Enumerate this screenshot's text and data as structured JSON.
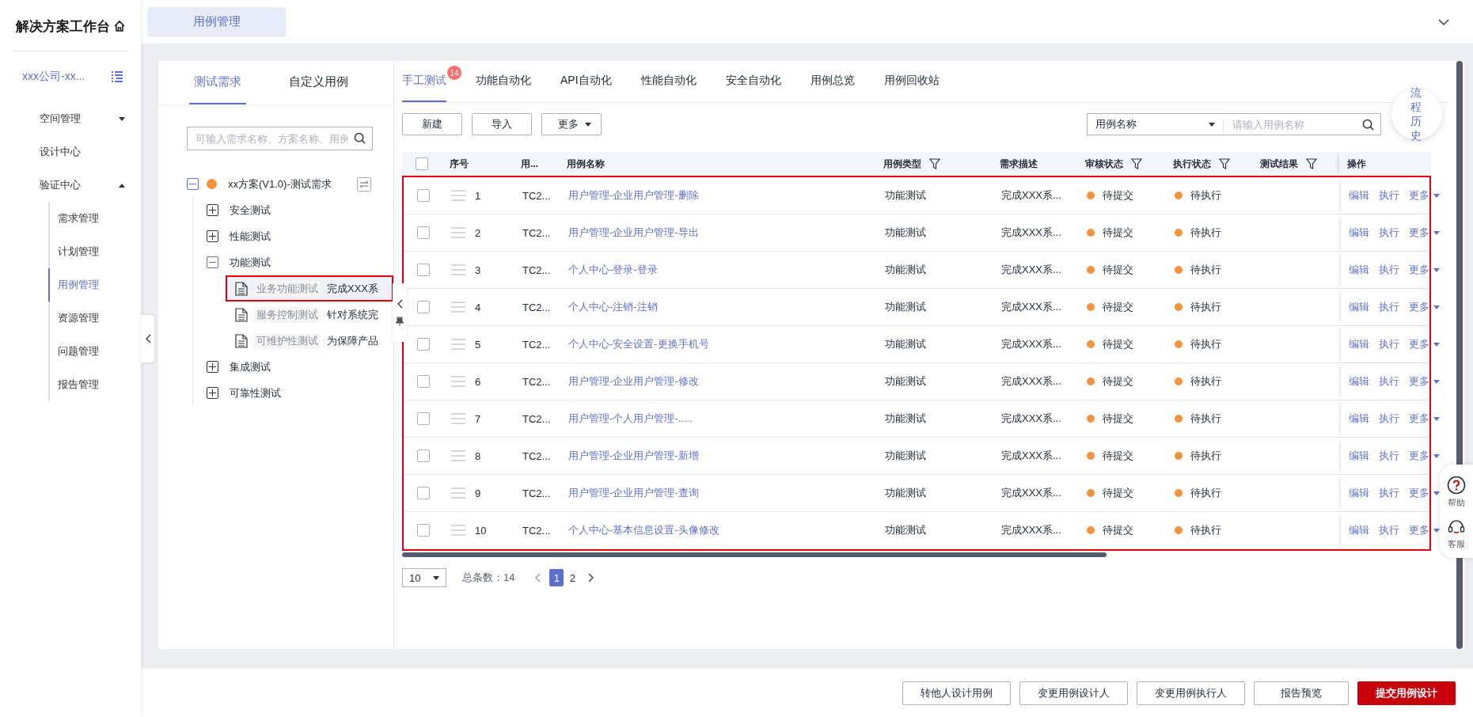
{
  "sidebar": {
    "title": "解决方案工作台",
    "org": "xxx公司-xx...",
    "items": [
      {
        "label": "空间管理",
        "expanded": false
      },
      {
        "label": "设计中心"
      },
      {
        "label": "验证中心",
        "expanded": true,
        "children": [
          {
            "label": "需求管理",
            "selected": false
          },
          {
            "label": "计划管理",
            "selected": false
          },
          {
            "label": "用例管理",
            "selected": true
          },
          {
            "label": "资源管理",
            "selected": false
          },
          {
            "label": "问题管理",
            "selected": false
          },
          {
            "label": "报告管理",
            "selected": false
          }
        ]
      }
    ]
  },
  "page_tab": "用例管理",
  "left_panel": {
    "tabs": [
      {
        "label": "测试需求",
        "selected": true
      },
      {
        "label": "自定义用例",
        "selected": false
      }
    ],
    "search": {
      "placeholder": "可输入需求名称、方案名称、用例"
    },
    "tree": {
      "label": "xx方案(V1.0)-测试需求",
      "color": "#f5923e",
      "expanded": true,
      "children": [
        {
          "kind": "group",
          "label": "安全测试",
          "expanded": false
        },
        {
          "kind": "group",
          "label": "性能测试",
          "expanded": false
        },
        {
          "kind": "group",
          "label": "功能测试",
          "expanded": true,
          "children": [
            {
              "kind": "doc",
              "label": "业务功能测试",
              "desc": "完成XXX系",
              "selected": true,
              "highlighted": true
            },
            {
              "kind": "doc",
              "label": "服务控制测试",
              "desc": "针对系统完",
              "selected": false,
              "highlighted": false
            },
            {
              "kind": "doc",
              "label": "可维护性测试",
              "desc": "为保障产品",
              "selected": false,
              "highlighted": false
            }
          ]
        },
        {
          "kind": "group",
          "label": "集成测试",
          "expanded": false
        },
        {
          "kind": "group",
          "label": "可靠性测试",
          "expanded": false
        }
      ]
    }
  },
  "tabs": [
    {
      "label": "手工测试",
      "selected": true,
      "badge": "14"
    },
    {
      "label": "功能自动化",
      "selected": false
    },
    {
      "label": "API自动化",
      "selected": false
    },
    {
      "label": "性能自动化",
      "selected": false
    },
    {
      "label": "安全自动化",
      "selected": false
    },
    {
      "label": "用例总览",
      "selected": false
    },
    {
      "label": "用例回收站",
      "selected": false
    }
  ],
  "toolbar": {
    "buttons": [
      {
        "label": "新建",
        "caret": false
      },
      {
        "label": "导入",
        "caret": false
      },
      {
        "label": "更多",
        "caret": true
      }
    ],
    "search_field": "用例名称",
    "search": {
      "placeholder": "请输入用例名称"
    }
  },
  "float_button": "流程历史",
  "table": {
    "highlighted": true,
    "all_checked": false,
    "columns": [
      {
        "label": "序号",
        "filter": false
      },
      {
        "label": "用...",
        "filter": false
      },
      {
        "label": "用例名称",
        "filter": false
      },
      {
        "label": "用例类型",
        "filter": true
      },
      {
        "label": "需求描述",
        "filter": false
      },
      {
        "label": "审核状态",
        "filter": true
      },
      {
        "label": "执行状态",
        "filter": true
      },
      {
        "label": "测试结果",
        "filter": true
      },
      {
        "label": "操作",
        "filter": false
      }
    ],
    "rows": [
      {
        "checked": false,
        "seq": "1",
        "id": "TC2...",
        "name": "用户管理-企业用户管理-删除",
        "type": "功能测试",
        "desc": "完成XXX系...",
        "audit": {
          "text": "待提交",
          "color": "#f5923e"
        },
        "exec": {
          "text": "待执行",
          "color": "#f5923e"
        },
        "actions": [
          "编辑",
          "执行",
          "更多"
        ]
      },
      {
        "checked": false,
        "seq": "2",
        "id": "TC2...",
        "name": "用户管理-企业用户管理-导出",
        "type": "功能测试",
        "desc": "完成XXX系...",
        "audit": {
          "text": "待提交",
          "color": "#f5923e"
        },
        "exec": {
          "text": "待执行",
          "color": "#f5923e"
        },
        "actions": [
          "编辑",
          "执行",
          "更多"
        ]
      },
      {
        "checked": false,
        "seq": "3",
        "id": "TC2...",
        "name": "个人中心-登录-登录",
        "type": "功能测试",
        "desc": "完成XXX系...",
        "audit": {
          "text": "待提交",
          "color": "#f5923e"
        },
        "exec": {
          "text": "待执行",
          "color": "#f5923e"
        },
        "actions": [
          "编辑",
          "执行",
          "更多"
        ]
      },
      {
        "checked": false,
        "seq": "4",
        "id": "TC2...",
        "name": "个人中心-注销-注销",
        "type": "功能测试",
        "desc": "完成XXX系...",
        "audit": {
          "text": "待提交",
          "color": "#f5923e"
        },
        "exec": {
          "text": "待执行",
          "color": "#f5923e"
        },
        "actions": [
          "编辑",
          "执行",
          "更多"
        ]
      },
      {
        "checked": false,
        "seq": "5",
        "id": "TC2...",
        "name": "个人中心-安全设置-更换手机号",
        "type": "功能测试",
        "desc": "完成XXX系...",
        "audit": {
          "text": "待提交",
          "color": "#f5923e"
        },
        "exec": {
          "text": "待执行",
          "color": "#f5923e"
        },
        "actions": [
          "编辑",
          "执行",
          "更多"
        ]
      },
      {
        "checked": false,
        "seq": "6",
        "id": "TC2...",
        "name": "用户管理-企业用户管理-修改",
        "type": "功能测试",
        "desc": "完成XXX系...",
        "audit": {
          "text": "待提交",
          "color": "#f5923e"
        },
        "exec": {
          "text": "待执行",
          "color": "#f5923e"
        },
        "actions": [
          "编辑",
          "执行",
          "更多"
        ]
      },
      {
        "checked": false,
        "seq": "7",
        "id": "TC2...",
        "name": "用户管理-个人用户管理-.....",
        "type": "功能测试",
        "desc": "完成XXX系...",
        "audit": {
          "text": "待提交",
          "color": "#f5923e"
        },
        "exec": {
          "text": "待执行",
          "color": "#f5923e"
        },
        "actions": [
          "编辑",
          "执行",
          "更多"
        ]
      },
      {
        "checked": false,
        "seq": "8",
        "id": "TC2...",
        "name": "用户管理-企业用户管理-新增",
        "type": "功能测试",
        "desc": "完成XXX系...",
        "audit": {
          "text": "待提交",
          "color": "#f5923e"
        },
        "exec": {
          "text": "待执行",
          "color": "#f5923e"
        },
        "actions": [
          "编辑",
          "执行",
          "更多"
        ]
      },
      {
        "checked": false,
        "seq": "9",
        "id": "TC2...",
        "name": "用户管理-企业用户管理-查询",
        "type": "功能测试",
        "desc": "完成XXX系...",
        "audit": {
          "text": "待提交",
          "color": "#f5923e"
        },
        "exec": {
          "text": "待执行",
          "color": "#f5923e"
        },
        "actions": [
          "编辑",
          "执行",
          "更多"
        ]
      },
      {
        "checked": false,
        "seq": "10",
        "id": "TC2...",
        "name": "个人中心-基本信息设置-头像修改",
        "type": "功能测试",
        "desc": "完成XXX系...",
        "audit": {
          "text": "待提交",
          "color": "#f5923e"
        },
        "exec": {
          "text": "待执行",
          "color": "#f5923e"
        },
        "actions": [
          "编辑",
          "执行",
          "更多"
        ]
      }
    ]
  },
  "pagination": {
    "page_size": "10",
    "total": "总条数：14",
    "pages": [
      {
        "label": "1",
        "selected": true
      },
      {
        "label": "2",
        "selected": false
      }
    ]
  },
  "help": [
    {
      "kind": "help",
      "label": "帮助"
    },
    {
      "kind": "service",
      "label": "客服"
    }
  ],
  "footer_buttons": [
    {
      "label": "转他人设计用例",
      "kind": "default"
    },
    {
      "label": "变更用例设计人",
      "kind": "default"
    },
    {
      "label": "变更用例执行人",
      "kind": "default"
    },
    {
      "label": "报告预览",
      "kind": "default"
    },
    {
      "label": "提交用例设计",
      "kind": "primary"
    }
  ]
}
